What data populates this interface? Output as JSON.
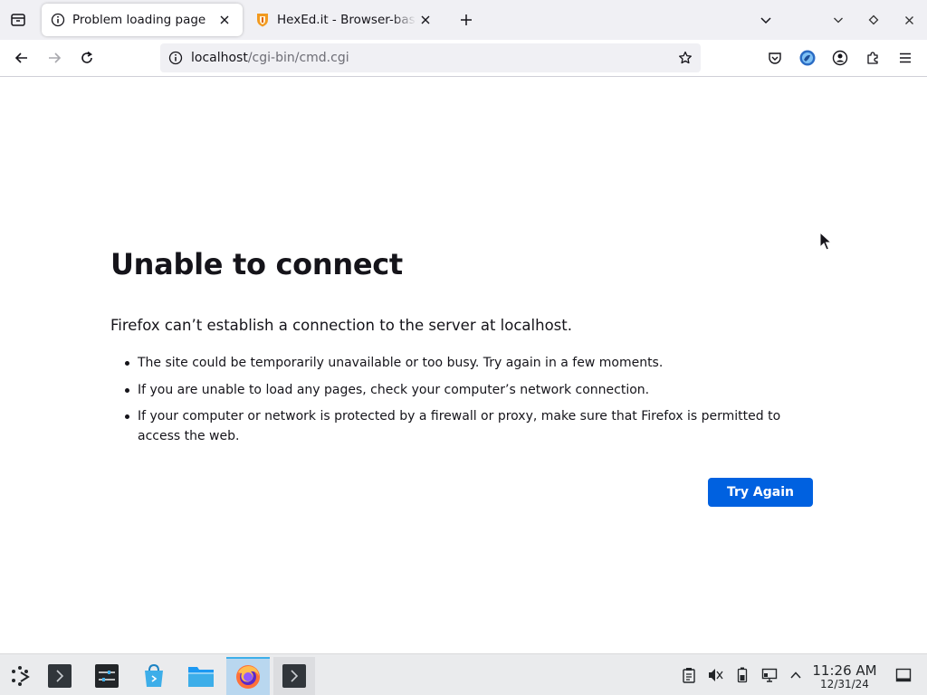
{
  "tabs": [
    {
      "title": "Problem loading page",
      "icon": "info-icon",
      "active": true
    },
    {
      "title": "HexEd.it - Browser-based online and offline hex editing",
      "icon": "hexed-shield-icon",
      "active": false
    }
  ],
  "url": {
    "host": "localhost",
    "path": "/cgi-bin/cmd.cgi"
  },
  "error": {
    "title": "Unable to connect",
    "description": "Firefox can’t establish a connection to the server at localhost.",
    "bullets": [
      "The site could be temporarily unavailable or too busy. Try again in a few moments.",
      "If you are unable to load any pages, check your computer’s network connection.",
      "If your computer or network is protected by a firewall or proxy, make sure that Firefox is permitted to access the web."
    ],
    "button_label": "Try Again"
  },
  "taskbar": {
    "apps": [
      "app-launcher-icon",
      "terminal-icon",
      "settings-icon",
      "software-center-icon",
      "file-manager-icon",
      "firefox-icon",
      "terminal-icon"
    ],
    "tray": [
      "clipboard-icon",
      "volume-muted-icon",
      "battery-icon",
      "network-icon",
      "expand-tray-icon"
    ],
    "clock": {
      "time": "11:26 AM",
      "date": "12/31/24"
    }
  },
  "colors": {
    "accent": "#0061e0",
    "tabstrip": "#f0f0f4",
    "taskbar": "#eaebed",
    "active_task": "#b9d7ef"
  }
}
